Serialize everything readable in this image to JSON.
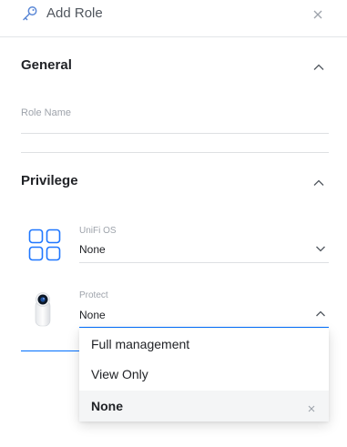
{
  "header": {
    "title": "Add Role",
    "icon": "key-icon"
  },
  "general": {
    "heading": "General",
    "role_name_placeholder": "Role Name",
    "role_name_value": ""
  },
  "privilege": {
    "heading": "Privilege",
    "apps": [
      {
        "label": "UniFi OS",
        "value": "None",
        "icon": "unifi-os-grid-icon"
      },
      {
        "label": "Protect",
        "value": "None",
        "icon": "protect-camera-icon"
      }
    ]
  },
  "dropdown": {
    "options": [
      {
        "label": "Full management",
        "selected": false
      },
      {
        "label": "View Only",
        "selected": false
      },
      {
        "label": "None",
        "selected": true
      }
    ]
  },
  "colors": {
    "accent": "#006fff",
    "text": "#212327",
    "muted": "#9ea3ab",
    "border": "#dee0e3"
  }
}
